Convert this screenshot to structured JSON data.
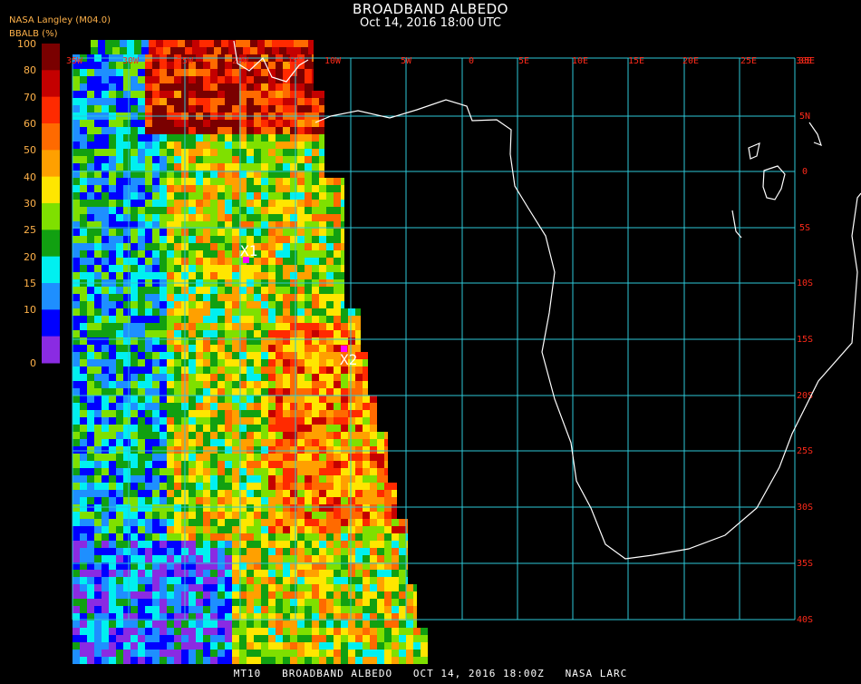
{
  "header": {
    "title": "BROADBAND ALBEDO",
    "subtitle": "Oct 14, 2016 18:00 UTC",
    "org": "NASA Langley (M04.0)",
    "unit_label": "BBALB (%)"
  },
  "legend": {
    "ticks": [
      "100",
      "80",
      "70",
      "60",
      "50",
      "40",
      "30",
      "25",
      "20",
      "15",
      "10",
      "0"
    ],
    "colors": [
      "#7a0000",
      "#c40000",
      "#ff2a00",
      "#ff6a00",
      "#ffa000",
      "#ffe600",
      "#7fe000",
      "#11a011",
      "#00f0f0",
      "#1e8fff",
      "#0000ff",
      "#8a2be2"
    ]
  },
  "grid": {
    "lon_labels": [
      "35W",
      "30W",
      "25W",
      "20W",
      "15W",
      "10W",
      "5W",
      "0",
      "5E",
      "10E",
      "15E",
      "20E",
      "25E",
      "30E",
      "35E"
    ],
    "lat_labels": [
      "5N",
      "0",
      "5S",
      "10S",
      "15S",
      "20S",
      "25S",
      "30S",
      "35S",
      "40S"
    ],
    "line_color": "#2ec8d8",
    "label_color": "#ff2a1a"
  },
  "markers": {
    "x1": "X1",
    "x2": "X2",
    "color": "#ff00ff"
  },
  "footer": "MT10   BROADBAND ALBEDO   OCT 14, 2016 18:00Z   NASA LARC"
}
